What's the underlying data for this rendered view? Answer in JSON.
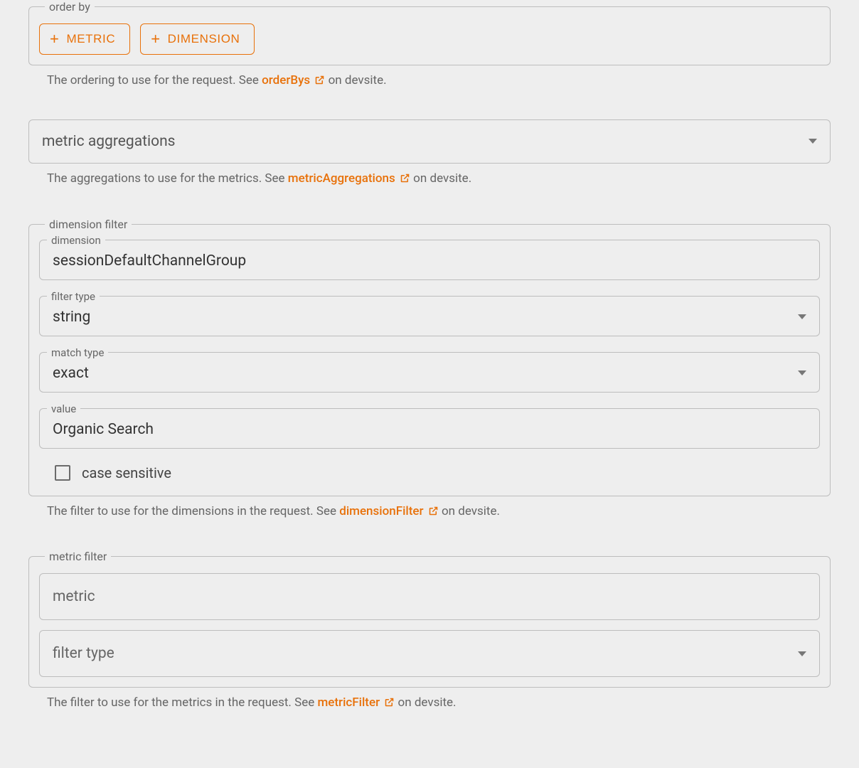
{
  "colors": {
    "accent": "#e8710a",
    "border": "#bdbdbd",
    "bg": "#eeeeee"
  },
  "orderBy": {
    "legend": "order by",
    "metricBtn": "METRIC",
    "dimensionBtn": "DIMENSION",
    "helperPrefix": "The ordering to use for the request. See ",
    "helperLink": "orderBys",
    "helperSuffix": " on devsite."
  },
  "metricAgg": {
    "label": "metric aggregations",
    "helperPrefix": "The aggregations to use for the metrics. See ",
    "helperLink": "metricAggregations",
    "helperSuffix": " on devsite."
  },
  "dimFilter": {
    "legend": "dimension filter",
    "dimension": {
      "legend": "dimension",
      "value": "sessionDefaultChannelGroup"
    },
    "filterType": {
      "legend": "filter type",
      "value": "string"
    },
    "matchType": {
      "legend": "match type",
      "value": "exact"
    },
    "value": {
      "legend": "value",
      "value": "Organic Search"
    },
    "caseSensitive": {
      "label": "case sensitive",
      "checked": false
    },
    "helperPrefix": "The filter to use for the dimensions in the request. See ",
    "helperLink": "dimensionFilter",
    "helperSuffix": " on devsite."
  },
  "metricFilter": {
    "legend": "metric filter",
    "metricPlaceholder": "metric",
    "filterTypePlaceholder": "filter type",
    "helperPrefix": "The filter to use for the metrics in the request. See ",
    "helperLink": "metricFilter",
    "helperSuffix": " on devsite."
  }
}
